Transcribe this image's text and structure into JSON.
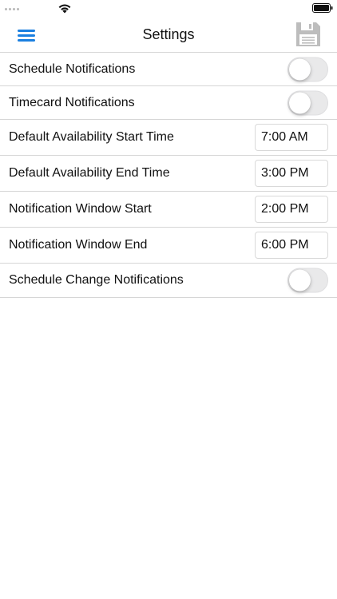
{
  "status_bar": {
    "icons": [
      "signal-dots-icon",
      "wifi-icon",
      "battery-icon"
    ]
  },
  "nav": {
    "title": "Settings",
    "menu_icon": "hamburger-menu-icon",
    "save_icon": "floppy-disk-icon",
    "accent_color": "#1a7fe0",
    "save_icon_color": "#bdbdbd"
  },
  "settings": {
    "schedule_notifications": {
      "label": "Schedule Notifications",
      "enabled": false
    },
    "timecard_notifications": {
      "label": "Timecard Notifications",
      "enabled": false
    },
    "default_start": {
      "label": "Default Availability Start Time",
      "value": "7:00 AM"
    },
    "default_end": {
      "label": "Default Availability End Time",
      "value": "3:00 PM"
    },
    "window_start": {
      "label": "Notification Window Start",
      "value": "2:00 PM"
    },
    "window_end": {
      "label": "Notification Window End",
      "value": "6:00 PM"
    },
    "schedule_change_notifications": {
      "label": "Schedule Change Notifications",
      "enabled": false
    }
  }
}
